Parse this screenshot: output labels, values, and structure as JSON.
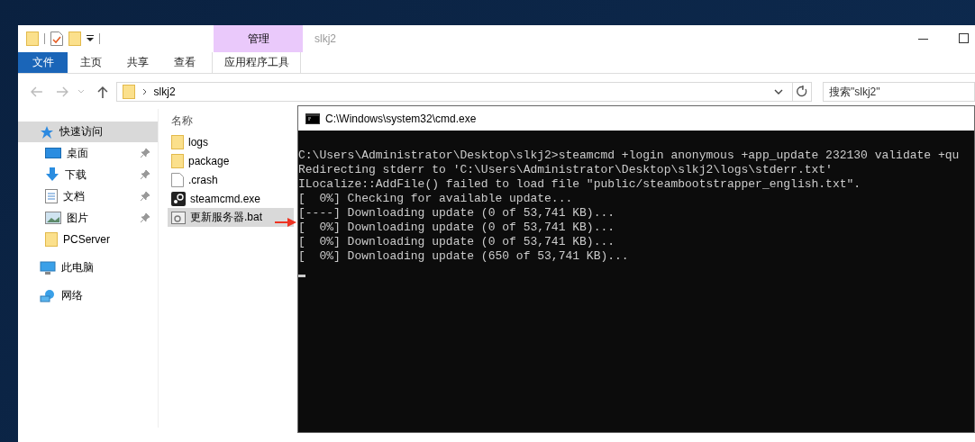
{
  "window": {
    "title": "slkj2"
  },
  "ribbon": {
    "file_button": "文件",
    "tabs": [
      "主页",
      "共享",
      "查看"
    ],
    "context_group": {
      "label": "管理",
      "tab": "应用程序工具"
    }
  },
  "address": {
    "path": "slkj2"
  },
  "search": {
    "placeholder": "搜索\"slkj2\""
  },
  "sidebar": {
    "items": [
      {
        "label": "快速访问",
        "kind": "quick",
        "selected": true,
        "children": [
          {
            "label": "桌面",
            "kind": "desktop",
            "pinned": true
          },
          {
            "label": "下载",
            "kind": "downloads",
            "pinned": true
          },
          {
            "label": "文档",
            "kind": "documents",
            "pinned": true
          },
          {
            "label": "图片",
            "kind": "pictures",
            "pinned": true
          },
          {
            "label": "PCServer",
            "kind": "folder",
            "pinned": false
          }
        ]
      },
      {
        "label": "此电脑",
        "kind": "pc",
        "selected": false
      },
      {
        "label": "网络",
        "kind": "network",
        "selected": false
      }
    ]
  },
  "file_list": {
    "column": "名称",
    "files": [
      {
        "name": "logs",
        "kind": "folder",
        "selected": false
      },
      {
        "name": "package",
        "kind": "folder",
        "selected": false
      },
      {
        "name": ".crash",
        "kind": "file",
        "selected": false
      },
      {
        "name": "steamcmd.exe",
        "kind": "steam",
        "selected": false
      },
      {
        "name": "更新服务器.bat",
        "kind": "batch",
        "selected": true
      }
    ]
  },
  "console": {
    "title": "C:\\Windows\\system32\\cmd.exe",
    "lines": [
      "C:\\Users\\Administrator\\Desktop\\slkj2>steamcmd +login anonymous +app_update 232130 validate +qu",
      "Redirecting stderr to 'C:\\Users\\Administrator\\Desktop\\slkj2\\logs\\stderr.txt'",
      "ILocalize::AddFile() failed to load file \"public/steambootstrapper_english.txt\".",
      "[  0%] Checking for available update...",
      "[----] Downloading update (0 of 53,741 KB)...",
      "[  0%] Downloading update (0 of 53,741 KB)...",
      "[  0%] Downloading update (0 of 53,741 KB)...",
      "[  0%] Downloading update (650 of 53,741 KB)..."
    ]
  }
}
